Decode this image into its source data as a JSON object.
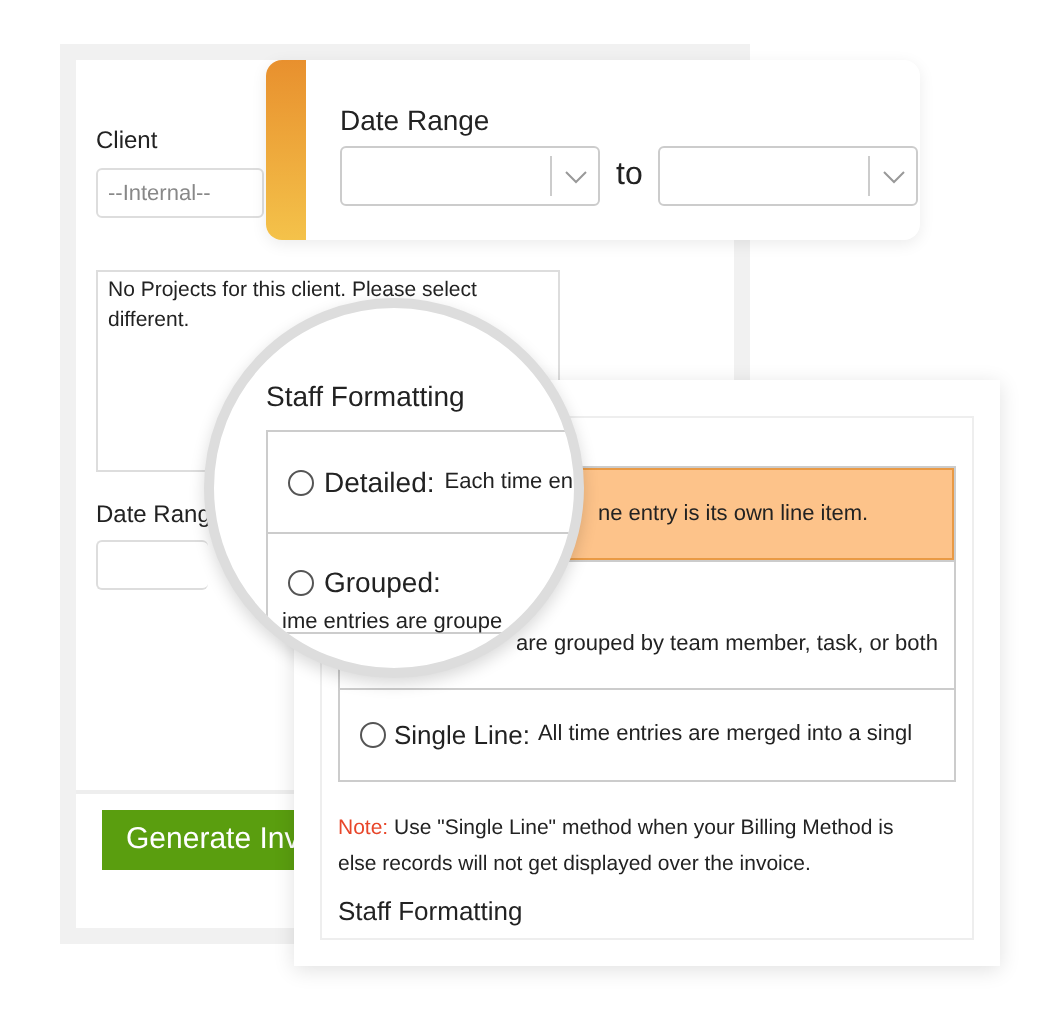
{
  "client_panel": {
    "client_label": "Client",
    "client_value": "--Internal--",
    "projects_message": "No Projects for this client. Please select different.",
    "date_label": "Date Rang",
    "generate_button": "Generate Inv"
  },
  "date_range_card": {
    "label": "Date Range",
    "separator": "to"
  },
  "formatting_card": {
    "options": [
      {
        "kind": "fragment",
        "text": "ne entry is its own line item.",
        "highlighted": true
      },
      {
        "kind": "fragment",
        "text": "are grouped by team member, task, or both",
        "highlighted": false
      },
      {
        "kind": "radio",
        "label": "Single Line:",
        "text": "All time entries are merged into a singl",
        "highlighted": false,
        "selected": false
      }
    ],
    "note": {
      "label": "Note:",
      "lines": [
        "Use \"Single Line\" method when your Billing Method is",
        "else records will not get displayed over the invoice."
      ]
    },
    "footer": "Staff Formatting"
  },
  "magnifier": {
    "heading": "Staff Formatting",
    "options": [
      {
        "label": "Detailed:",
        "text": "Each time en",
        "selected": false
      },
      {
        "label": "Grouped:",
        "text": "ime entries are groupe",
        "selected": false
      }
    ]
  }
}
